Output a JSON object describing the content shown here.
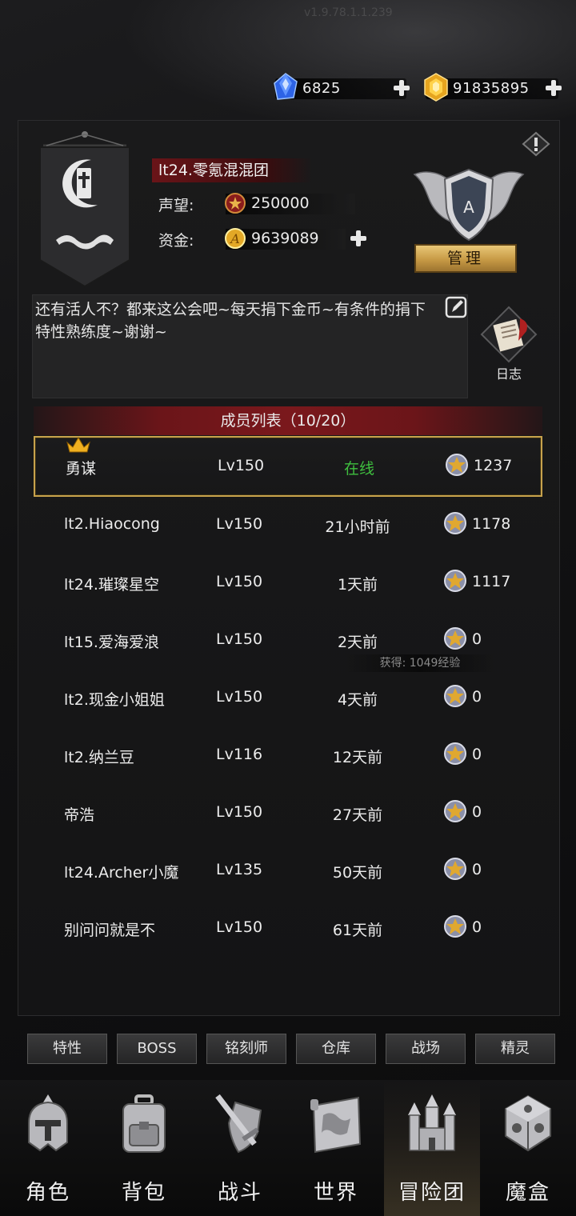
{
  "app": {
    "version": "v1.9.78.1.1.239"
  },
  "currency": {
    "gems": {
      "value": "6825",
      "color": "#3a7bff"
    },
    "gold": {
      "value": "91835895",
      "color": "#f0b42a"
    }
  },
  "guild": {
    "name": "lt24.零氪混混团",
    "reputation_label": "声望:",
    "reputation_value": "250000",
    "funds_label": "资金:",
    "funds_value": "9639089",
    "rank_letter": "A",
    "manage_label": "管理",
    "notice": "还有活人不？都来这公会吧~每天捐下金币~有条件的捐下特性熟练度~谢谢~",
    "log_label": "日志"
  },
  "members": {
    "header": "成员列表（10/20）",
    "online_color": "#3fbf3f",
    "rows": [
      {
        "name": "勇谋",
        "level": "Lv150",
        "status": "在线",
        "contribution": "1237"
      },
      {
        "name": "lt2.Hiaocong",
        "level": "Lv150",
        "status": "21小时前",
        "contribution": "1178"
      },
      {
        "name": "lt24.璀璨星空",
        "level": "Lv150",
        "status": "1天前",
        "contribution": "1117"
      },
      {
        "name": "lt15.爱海爱浪",
        "level": "Lv150",
        "status": "2天前",
        "contribution": "0"
      },
      {
        "name": "lt2.现金小姐姐",
        "level": "Lv150",
        "status": "4天前",
        "contribution": "0"
      },
      {
        "name": "lt2.纳兰豆",
        "level": "Lv116",
        "status": "12天前",
        "contribution": "0"
      },
      {
        "name": "帝浩",
        "level": "Lv150",
        "status": "27天前",
        "contribution": "0"
      },
      {
        "name": "lt24.Archer小魔",
        "level": "Lv135",
        "status": "50天前",
        "contribution": "0"
      },
      {
        "name": "别问问就是不",
        "level": "Lv150",
        "status": "61天前",
        "contribution": "0"
      }
    ],
    "toast": "获得: 1049经验"
  },
  "sub_buttons": [
    "特性",
    "BOSS",
    "铭刻师",
    "仓库",
    "战场",
    "精灵"
  ],
  "nav": [
    {
      "label": "角色",
      "icon": "helmet-icon"
    },
    {
      "label": "背包",
      "icon": "backpack-icon"
    },
    {
      "label": "战斗",
      "icon": "sword-shield-icon"
    },
    {
      "label": "世界",
      "icon": "map-icon"
    },
    {
      "label": "冒险团",
      "icon": "castle-icon"
    },
    {
      "label": "魔盒",
      "icon": "cube-icon"
    }
  ]
}
